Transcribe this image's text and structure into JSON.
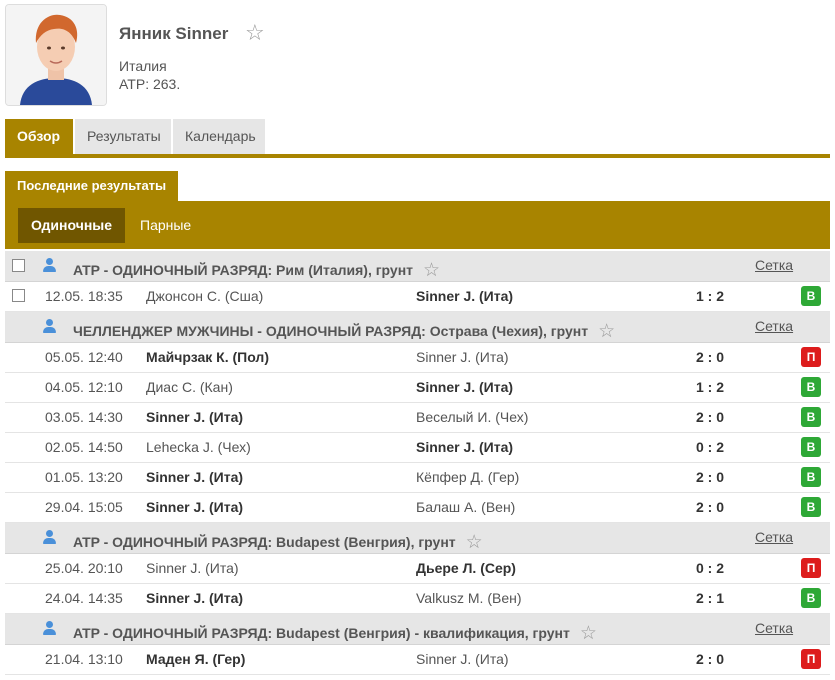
{
  "player": {
    "name": "Янник Sinner",
    "country": "Италия",
    "rank": "ATP: 263."
  },
  "tabs": [
    {
      "label": "Обзор",
      "active": true
    },
    {
      "label": "Результаты",
      "active": false
    },
    {
      "label": "Календарь",
      "active": false
    }
  ],
  "section": {
    "title": "Последние результаты",
    "subtabs": [
      {
        "label": "Одиночные",
        "active": true
      },
      {
        "label": "Парные",
        "active": false
      }
    ]
  },
  "draw_label": "Сетка",
  "groups": [
    {
      "title": "ATP - ОДИНОЧНЫЙ РАЗРЯД: Рим (Италия), грунт",
      "matches": [
        {
          "time": "12.05. 18:35",
          "home": "Джонсон С. (Сша)",
          "away": "Sinner J. (Ита)",
          "score": "1 : 2",
          "result": "В"
        }
      ]
    },
    {
      "title": "ЧЕЛЛЕНДЖЕР МУЖЧИНЫ - ОДИНОЧНЫЙ РАЗРЯД: Острава (Чехия), грунт",
      "matches": [
        {
          "time": "05.05. 12:40",
          "home": "Майчрзак К. (Пол)",
          "away": "Sinner J. (Ита)",
          "score": "2 : 0",
          "result": "П"
        },
        {
          "time": "04.05. 12:10",
          "home": "Диас С. (Кан)",
          "away": "Sinner J. (Ита)",
          "score": "1 : 2",
          "result": "В"
        },
        {
          "time": "03.05. 14:30",
          "home": "Sinner J. (Ита)",
          "away": "Веселый И. (Чех)",
          "score": "2 : 0",
          "result": "В"
        },
        {
          "time": "02.05. 14:50",
          "home": "Lehecka J. (Чех)",
          "away": "Sinner J. (Ита)",
          "score": "0 : 2",
          "result": "В"
        },
        {
          "time": "01.05. 13:20",
          "home": "Sinner J. (Ита)",
          "away": "Кёпфер Д. (Гер)",
          "score": "2 : 0",
          "result": "В"
        },
        {
          "time": "29.04. 15:05",
          "home": "Sinner J. (Ита)",
          "away": "Балаш А. (Вен)",
          "score": "2 : 0",
          "result": "В"
        }
      ]
    },
    {
      "title": "ATP - ОДИНОЧНЫЙ РАЗРЯД: Budapest (Венгрия), грунт",
      "matches": [
        {
          "time": "25.04. 20:10",
          "home": "Sinner J. (Ита)",
          "away": "Дьере Л. (Сер)",
          "score": "0 : 2",
          "result": "П"
        },
        {
          "time": "24.04. 14:35",
          "home": "Sinner J. (Ита)",
          "away": "Valkusz M. (Вен)",
          "score": "2 : 1",
          "result": "В"
        }
      ]
    },
    {
      "title": "ATP - ОДИНОЧНЫЙ РАЗРЯД: Budapest (Венгрия) - квалификация, грунт",
      "matches": [
        {
          "time": "21.04. 13:10",
          "home": "Маден Я. (Гер)",
          "away": "Sinner J. (Ита)",
          "score": "2 : 0",
          "result": "П"
        }
      ]
    }
  ]
}
